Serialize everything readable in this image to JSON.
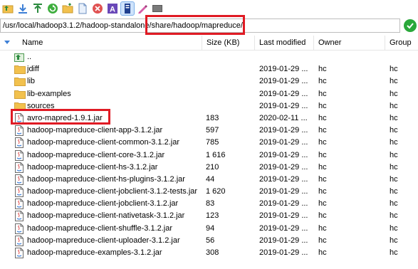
{
  "toolbar": {
    "buttons": [
      {
        "icon": "parent-directory-icon"
      },
      {
        "icon": "download-icon"
      },
      {
        "icon": "upload-icon"
      },
      {
        "icon": "refresh-icon"
      },
      {
        "icon": "new-folder-icon"
      },
      {
        "icon": "new-file-icon"
      },
      {
        "icon": "delete-icon"
      },
      {
        "icon": "rename-icon"
      },
      {
        "icon": "properties-icon"
      },
      {
        "icon": "edit-icon"
      },
      {
        "icon": "terminal-icon"
      }
    ]
  },
  "path": {
    "value": "/usr/local/hadoop3.1.2/hadoop-standalone/share/hadoop/mapreduce/"
  },
  "columns": {
    "name": "Name",
    "size": "Size (KB)",
    "modified": "Last modified",
    "owner": "Owner",
    "group": "Group"
  },
  "files": [
    {
      "name": "..",
      "type": "parent",
      "size": "",
      "modified": "",
      "owner": "",
      "group": ""
    },
    {
      "name": "jdiff",
      "type": "folder",
      "size": "",
      "modified": "2019-01-29 ...",
      "owner": "hc",
      "group": "hc"
    },
    {
      "name": "lib",
      "type": "folder",
      "size": "",
      "modified": "2019-01-29 ...",
      "owner": "hc",
      "group": "hc"
    },
    {
      "name": "lib-examples",
      "type": "folder",
      "size": "",
      "modified": "2019-01-29 ...",
      "owner": "hc",
      "group": "hc"
    },
    {
      "name": "sources",
      "type": "folder",
      "size": "",
      "modified": "2019-01-29 ...",
      "owner": "hc",
      "group": "hc"
    },
    {
      "name": "avro-mapred-1.9.1.jar",
      "type": "jar",
      "size": "183",
      "modified": "2020-02-11 ...",
      "owner": "hc",
      "group": "hc"
    },
    {
      "name": "hadoop-mapreduce-client-app-3.1.2.jar",
      "type": "jar",
      "size": "597",
      "modified": "2019-01-29 ...",
      "owner": "hc",
      "group": "hc"
    },
    {
      "name": "hadoop-mapreduce-client-common-3.1.2.jar",
      "type": "jar",
      "size": "785",
      "modified": "2019-01-29 ...",
      "owner": "hc",
      "group": "hc"
    },
    {
      "name": "hadoop-mapreduce-client-core-3.1.2.jar",
      "type": "jar",
      "size": "1 616",
      "modified": "2019-01-29 ...",
      "owner": "hc",
      "group": "hc"
    },
    {
      "name": "hadoop-mapreduce-client-hs-3.1.2.jar",
      "type": "jar",
      "size": "210",
      "modified": "2019-01-29 ...",
      "owner": "hc",
      "group": "hc"
    },
    {
      "name": "hadoop-mapreduce-client-hs-plugins-3.1.2.jar",
      "type": "jar",
      "size": "44",
      "modified": "2019-01-29 ...",
      "owner": "hc",
      "group": "hc"
    },
    {
      "name": "hadoop-mapreduce-client-jobclient-3.1.2-tests.jar",
      "type": "jar",
      "size": "1 620",
      "modified": "2019-01-29 ...",
      "owner": "hc",
      "group": "hc"
    },
    {
      "name": "hadoop-mapreduce-client-jobclient-3.1.2.jar",
      "type": "jar",
      "size": "83",
      "modified": "2019-01-29 ...",
      "owner": "hc",
      "group": "hc"
    },
    {
      "name": "hadoop-mapreduce-client-nativetask-3.1.2.jar",
      "type": "jar",
      "size": "123",
      "modified": "2019-01-29 ...",
      "owner": "hc",
      "group": "hc"
    },
    {
      "name": "hadoop-mapreduce-client-shuffle-3.1.2.jar",
      "type": "jar",
      "size": "94",
      "modified": "2019-01-29 ...",
      "owner": "hc",
      "group": "hc"
    },
    {
      "name": "hadoop-mapreduce-client-uploader-3.1.2.jar",
      "type": "jar",
      "size": "56",
      "modified": "2019-01-29 ...",
      "owner": "hc",
      "group": "hc"
    },
    {
      "name": "hadoop-mapreduce-examples-3.1.2.jar",
      "type": "jar",
      "size": "308",
      "modified": "2019-01-29 ...",
      "owner": "hc",
      "group": "hc"
    }
  ],
  "colors": {
    "highlight": "#e01b24",
    "folder": "#f2c14e",
    "accent": "#3d7fd6"
  }
}
